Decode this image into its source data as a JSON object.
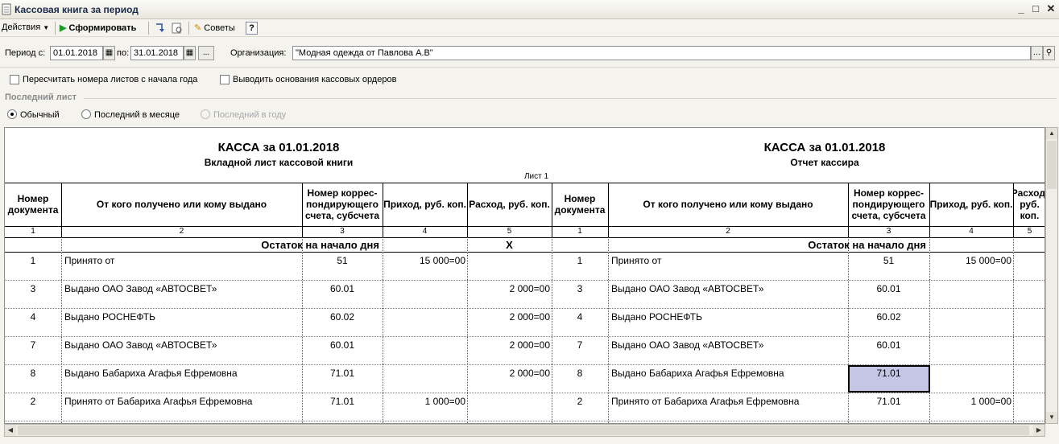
{
  "window": {
    "title": "Кассовая книга за период"
  },
  "toolbar": {
    "actions": "Действия",
    "generate": "Сформировать",
    "tips": "Советы",
    "help": "?"
  },
  "period": {
    "from_label": "Период с:",
    "from": "01.01.2018",
    "to_label": "по:",
    "to": "31.01.2018",
    "dots": "...",
    "org_label": "Организация:",
    "org": "\"Модная одежда от Павлова А.В\""
  },
  "options": {
    "recalc": "Пересчитать номера листов с начала года",
    "basis": "Выводить основания кассовых ордеров"
  },
  "last_sheet": {
    "label": "Последний лист",
    "normal": "Обычный",
    "month": "Последний в месяце",
    "year": "Последний в году"
  },
  "report": {
    "left": {
      "title": "КАССА за 01.01.2018",
      "subtitle": "Вкладной лист кассовой книги"
    },
    "right": {
      "title": "КАССА за 01.01.2018",
      "subtitle": "Отчет кассира"
    },
    "sheet": "Лист 1",
    "headers": [
      "Номер документа",
      "От кого получено или кому выдано",
      "Номер коррес-пондирующего счета, субсчета",
      "Приход, руб. коп.",
      "Расход, руб. коп."
    ],
    "col_nums": [
      "1",
      "2",
      "3",
      "4",
      "5"
    ],
    "opening": "Остаток на начало дня",
    "opening_x": "X",
    "rows": [
      {
        "doc": "1",
        "who": "Принято от",
        "acc": "51",
        "in": "15 000=00",
        "out": ""
      },
      {
        "doc": "3",
        "who": "Выдано ОАО Завод «АВТОСВЕТ»",
        "acc": "60.01",
        "in": "",
        "out": "2 000=00"
      },
      {
        "doc": "4",
        "who": "Выдано РОСНЕФТЬ",
        "acc": "60.02",
        "in": "",
        "out": "2 000=00"
      },
      {
        "doc": "7",
        "who": "Выдано ОАО Завод «АВТОСВЕТ»",
        "acc": "60.01",
        "in": "",
        "out": "2 000=00"
      },
      {
        "doc": "8",
        "who": "Выдано Бабариха Агафья Ефремовна",
        "acc": "71.01",
        "in": "",
        "out": "2 000=00"
      },
      {
        "doc": "2",
        "who": "Принято от Бабариха Агафья Ефремовна",
        "acc": "71.01",
        "in": "1 000=00",
        "out": ""
      }
    ]
  },
  "colors": {
    "selected_cell": "#c5c6e6",
    "generate_icon": "#1a9b2a"
  }
}
